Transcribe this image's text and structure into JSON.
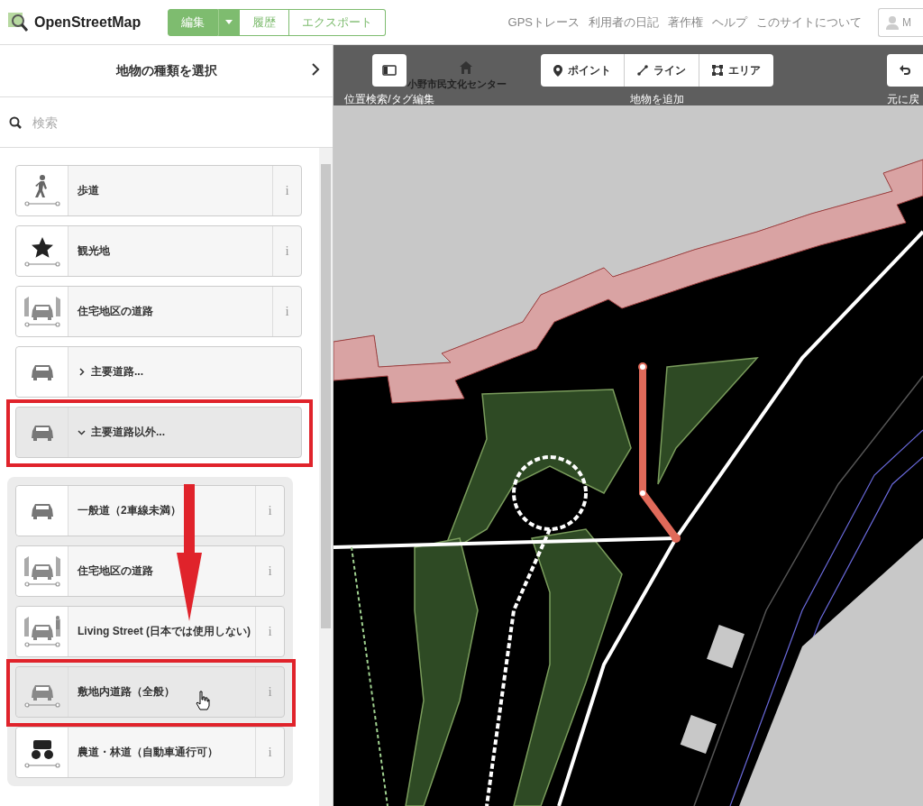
{
  "header": {
    "logo": "OpenStreetMap",
    "edit": "編集",
    "tabs": [
      "履歴",
      "エクスポート"
    ],
    "nav": [
      "GPSトレース",
      "利用者の日記",
      "著作権",
      "ヘルプ",
      "このサイトについて"
    ],
    "user": "M"
  },
  "sidebar": {
    "title": "地物の種類を選択",
    "search": {
      "placeholder": "検索"
    },
    "items": [
      {
        "label": "歩道",
        "info": "i",
        "kind": "preset",
        "hovered": false,
        "highlighted": false
      },
      {
        "label": "観光地",
        "info": "i",
        "kind": "preset",
        "hovered": false,
        "highlighted": false
      },
      {
        "label": "住宅地区の道路",
        "info": "i",
        "kind": "preset",
        "hovered": false,
        "highlighted": false
      },
      {
        "label": "主要道路...",
        "kind": "category",
        "expanded": false,
        "highlighted": false
      },
      {
        "label": "主要道路以外...",
        "kind": "category",
        "expanded": true,
        "highlighted": true,
        "children": [
          {
            "label": "一般道（2車線未満）",
            "info": "i",
            "kind": "preset",
            "hovered": false,
            "highlighted": false
          },
          {
            "label": "住宅地区の道路",
            "info": "i",
            "kind": "preset",
            "hovered": false,
            "highlighted": false
          },
          {
            "label": "Living Street (日本では使用しない)",
            "info": "i",
            "kind": "preset",
            "hovered": false,
            "highlighted": false
          },
          {
            "label": "敷地内道路（全般）",
            "info": "i",
            "kind": "preset",
            "hovered": true,
            "highlighted": true
          },
          {
            "label": "農道・林道（自動車通行可）",
            "info": "i",
            "kind": "preset",
            "hovered": false,
            "highlighted": false
          }
        ]
      }
    ]
  },
  "map": {
    "place_label": "小野市民文化センター",
    "toolbar": {
      "sidebar_label": "位置検索/タグ編集",
      "add_buttons": [
        "ポイント",
        "ライン",
        "エリア"
      ],
      "add_label": "地物を追加",
      "undo_label": "元に戻"
    }
  }
}
